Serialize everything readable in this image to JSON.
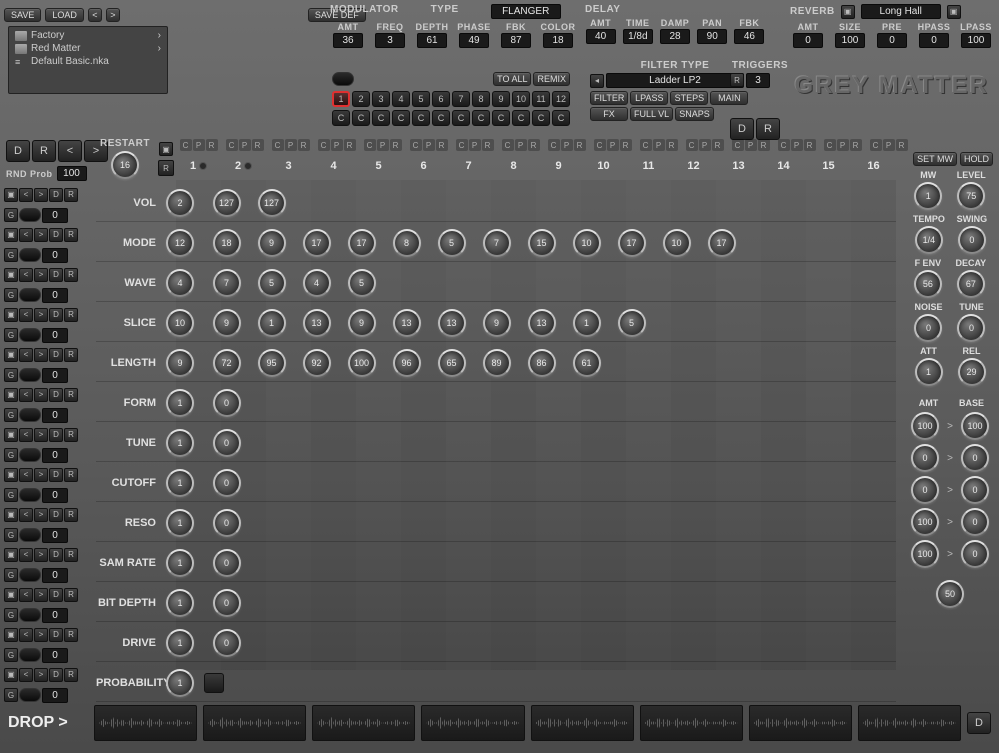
{
  "topbar": {
    "save": "SAVE",
    "load": "LOAD",
    "left": "<",
    "right": ">",
    "savedef": "SAVE DEF"
  },
  "presets": {
    "items": [
      "Factory",
      "Red Matter",
      "Default Basic.nka"
    ]
  },
  "modulator": {
    "title": "MODULATOR",
    "type_label": "TYPE",
    "type_value": "FLANGER",
    "params": [
      {
        "label": "AMT",
        "val": "36"
      },
      {
        "label": "FREQ",
        "val": "3"
      },
      {
        "label": "DEPTH",
        "val": "61"
      },
      {
        "label": "PHASE",
        "val": "49"
      },
      {
        "label": "FBK",
        "val": "87"
      },
      {
        "label": "COLOR",
        "val": "18"
      }
    ],
    "toall": "TO ALL",
    "remix": "REMIX"
  },
  "delay": {
    "title": "DELAY",
    "params": [
      {
        "label": "AMT",
        "val": "40"
      },
      {
        "label": "TIME",
        "val": "1/8d"
      },
      {
        "label": "DAMP",
        "val": "28"
      },
      {
        "label": "PAN",
        "val": "90"
      },
      {
        "label": "FBK",
        "val": "46"
      }
    ]
  },
  "reverb": {
    "title": "REVERB",
    "ir": "Long Hall",
    "params": [
      {
        "label": "AMT",
        "val": "0"
      },
      {
        "label": "SIZE",
        "val": "100"
      },
      {
        "label": "PRE",
        "val": "0"
      },
      {
        "label": "HPASS",
        "val": "0"
      },
      {
        "label": "LPASS",
        "val": "100"
      }
    ]
  },
  "filter": {
    "title": "FILTER TYPE",
    "value": "Ladder LP2",
    "btns": [
      "FILTER",
      "LPASS",
      "STEPS",
      "MAIN",
      "FX",
      "FULL VL",
      "SNAPS"
    ]
  },
  "triggers": {
    "title": "TRIGGERS",
    "r": "R",
    "val": "3",
    "d": "D",
    "r2": "R"
  },
  "logo": "GREY MATTER",
  "channels": {
    "count": 12,
    "c": "C"
  },
  "leftTop": {
    "d": "D",
    "r": "R",
    "lt": "<",
    "gt": ">",
    "rnd": "RND Prob",
    "rndval": "100"
  },
  "restart": {
    "label": "RESTART",
    "val": "16",
    "r": "R"
  },
  "steps": 16,
  "cpr": [
    "C",
    "P",
    "R"
  ],
  "rows": [
    {
      "name": "VOL",
      "master": "2",
      "vals": [
        "127",
        "127"
      ]
    },
    {
      "name": "MODE",
      "master": "12",
      "vals": [
        "18",
        "9",
        "17",
        "17",
        "8",
        "5",
        "7",
        "15",
        "10",
        "17",
        "10",
        "17"
      ]
    },
    {
      "name": "WAVE",
      "master": "4",
      "vals": [
        "7",
        "5",
        "4",
        "5"
      ]
    },
    {
      "name": "SLICE",
      "master": "10",
      "vals": [
        "9",
        "1",
        "13",
        "9",
        "13",
        "13",
        "9",
        "13",
        "1",
        "5"
      ]
    },
    {
      "name": "LENGTH",
      "master": "9",
      "vals": [
        "72",
        "95",
        "92",
        "100",
        "96",
        "65",
        "89",
        "86",
        "61"
      ]
    },
    {
      "name": "FORM",
      "master": "1",
      "vals": [
        "0"
      ]
    },
    {
      "name": "TUNE",
      "master": "1",
      "vals": [
        "0"
      ]
    },
    {
      "name": "CUTOFF",
      "master": "1",
      "vals": [
        "0"
      ]
    },
    {
      "name": "RESO",
      "master": "1",
      "vals": [
        "0"
      ]
    },
    {
      "name": "SAM RATE",
      "master": "1",
      "vals": [
        "0"
      ]
    },
    {
      "name": "BIT DEPTH",
      "master": "1",
      "vals": [
        "0"
      ]
    },
    {
      "name": "DRIVE",
      "master": "1",
      "vals": [
        "0"
      ]
    },
    {
      "name": "PROBABILITY",
      "master": "1",
      "vals": []
    }
  ],
  "right": {
    "setmw": "SET MW",
    "hold": "HOLD",
    "pairs": [
      {
        "a": {
          "l": "MW",
          "v": "1"
        },
        "b": {
          "l": "LEVEL",
          "v": "75"
        }
      },
      {
        "a": {
          "l": "TEMPO",
          "v": "1/4"
        },
        "b": {
          "l": "SWING",
          "v": "0"
        }
      },
      {
        "a": {
          "l": "F ENV",
          "v": "56"
        },
        "b": {
          "l": "DECAY",
          "v": "67"
        }
      },
      {
        "a": {
          "l": "NOISE",
          "v": "0"
        },
        "b": {
          "l": "TUNE",
          "v": "0"
        }
      },
      {
        "a": {
          "l": "ATT",
          "v": "1"
        },
        "b": {
          "l": "REL",
          "v": "29"
        }
      }
    ],
    "amt": "AMT",
    "base": "BASE",
    "amtbase": [
      {
        "a": "100",
        "b": "100"
      },
      {
        "a": "0",
        "b": "0"
      },
      {
        "a": "0",
        "b": "0"
      },
      {
        "a": "100",
        "b": "0"
      },
      {
        "a": "100",
        "b": "0"
      }
    ],
    "prob": "50",
    "d": "D"
  },
  "drop": "DROP >",
  "leftbtns": {
    "g": "G",
    "lt": "<",
    "gt": ">",
    "d": "D",
    "r": "R",
    "zero": "0"
  }
}
